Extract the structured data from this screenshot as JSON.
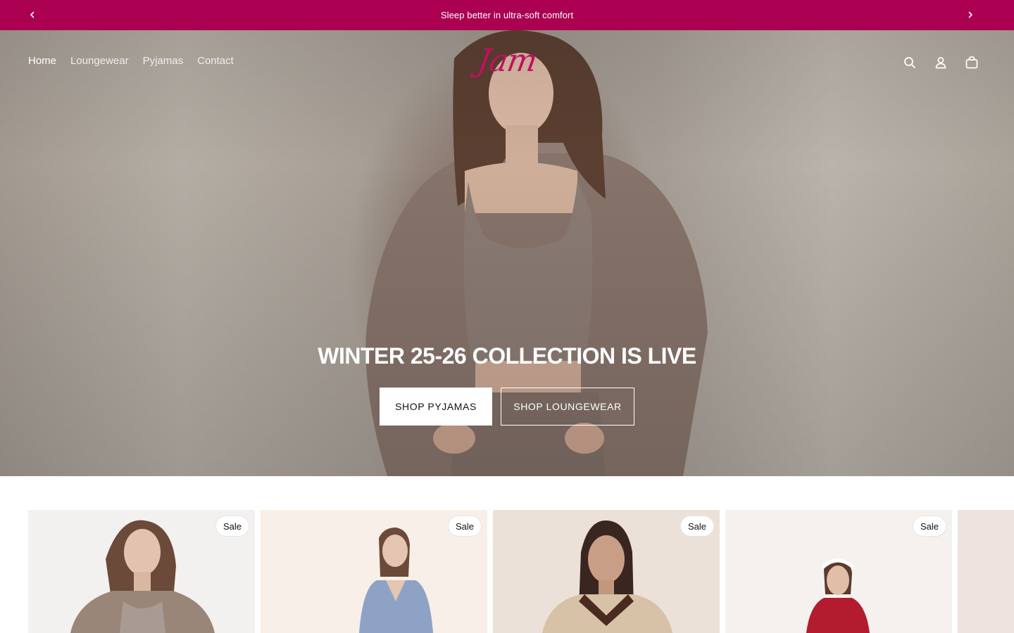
{
  "announcement": {
    "text": "Sleep better in ultra-soft comfort",
    "prev_icon": "chevron-left-icon",
    "next_icon": "chevron-right-icon",
    "background": "#ab0051"
  },
  "header": {
    "nav": [
      {
        "label": "Home",
        "active": true
      },
      {
        "label": "Loungewear",
        "active": false
      },
      {
        "label": "Pyjamas",
        "active": false
      },
      {
        "label": "Contact",
        "active": false
      }
    ],
    "logo": "Jam",
    "icons": [
      "search-icon",
      "account-icon",
      "cart-icon"
    ]
  },
  "hero": {
    "title": "WINTER 25-26 COLLECTION IS LIVE",
    "buttons": [
      {
        "label": "SHOP PYJAMAS"
      },
      {
        "label": "SHOP LOUNGEWEAR"
      }
    ]
  },
  "products": [
    {
      "badge": "Sale",
      "outfit_color": "#9a8679"
    },
    {
      "badge": "Sale",
      "outfit_color": "#8ea2c6"
    },
    {
      "badge": "Sale",
      "outfit_color": "#d7c2a7"
    },
    {
      "badge": "Sale",
      "outfit_color": "#b31b2f"
    },
    {
      "badge": "",
      "outfit_color": "#efe3e0"
    }
  ],
  "colors": {
    "brand": "#ab0051",
    "logo": "#c01060"
  }
}
